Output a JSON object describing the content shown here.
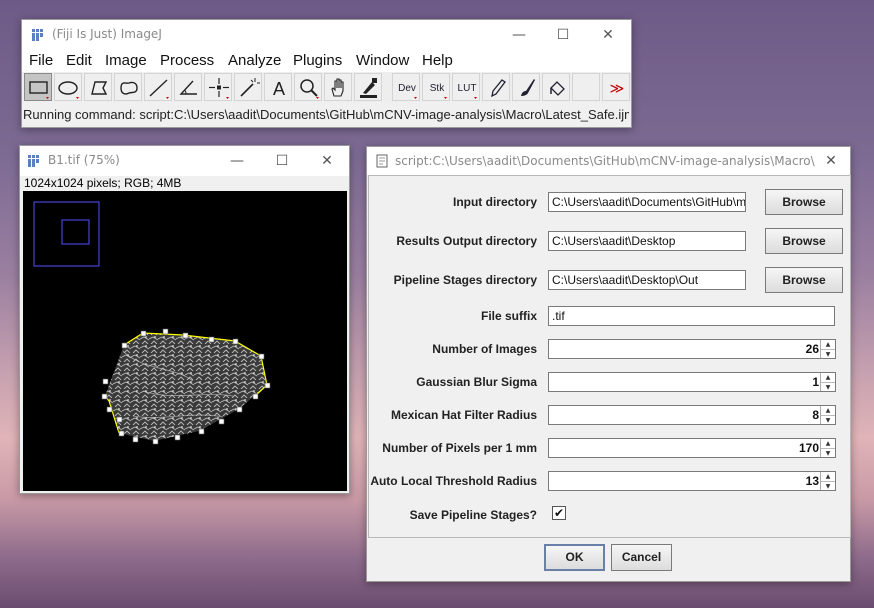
{
  "imagej": {
    "title": "(Fiji Is Just) ImageJ",
    "menus": [
      "File",
      "Edit",
      "Image",
      "Process",
      "Analyze",
      "Plugins",
      "Window",
      "Help"
    ],
    "tools": [
      {
        "name": "rectangle-tool-icon",
        "label": ""
      },
      {
        "name": "oval-tool-icon",
        "label": ""
      },
      {
        "name": "polygon-tool-icon",
        "label": ""
      },
      {
        "name": "freehand-tool-icon",
        "label": ""
      },
      {
        "name": "line-tool-icon",
        "label": ""
      },
      {
        "name": "angle-tool-icon",
        "label": ""
      },
      {
        "name": "point-tool-icon",
        "label": ""
      },
      {
        "name": "wand-tool-icon",
        "label": ""
      },
      {
        "name": "text-tool-icon",
        "label": "A"
      },
      {
        "name": "magnifier-tool-icon",
        "label": ""
      },
      {
        "name": "hand-tool-icon",
        "label": ""
      },
      {
        "name": "dropper-tool-icon",
        "label": ""
      },
      {
        "name": "dev-tool-icon",
        "label": "Dev"
      },
      {
        "name": "stk-tool-icon",
        "label": "Stk"
      },
      {
        "name": "lut-tool-icon",
        "label": "LUT"
      },
      {
        "name": "pencil-tool-icon",
        "label": ""
      },
      {
        "name": "brush-tool-icon",
        "label": ""
      },
      {
        "name": "flood-fill-tool-icon",
        "label": ""
      },
      {
        "name": "empty-tool-slot",
        "label": ""
      },
      {
        "name": "more-tools-icon",
        "label": "≫"
      }
    ],
    "status": "Running command: script:C:\\Users\\aadit\\Documents\\GitHub\\mCNV-image-analysis\\Macro\\Latest_Safe.ijm"
  },
  "image_window": {
    "title": "B1.tif (75%)",
    "info": "1024x1024 pixels; RGB; 4MB"
  },
  "dialog": {
    "title": "script:C:\\Users\\aadit\\Documents\\GitHub\\mCNV-image-analysis\\Macro\\Latest_Safe.ijm",
    "fields": {
      "input_dir": {
        "label": "Input directory",
        "value": "C:\\Users\\aadit\\Documents\\GitHub\\mCNV-image-analysis",
        "button": "Browse"
      },
      "results_dir": {
        "label": "Results Output directory",
        "value": "C:\\Users\\aadit\\Desktop",
        "button": "Browse"
      },
      "stages_dir": {
        "label": "Pipeline Stages directory",
        "value": "C:\\Users\\aadit\\Desktop\\Out",
        "button": "Browse"
      },
      "file_suffix": {
        "label": "File suffix",
        "value": ".tif"
      },
      "num_images": {
        "label": "Number of Images",
        "value": "26"
      },
      "blur_sigma": {
        "label": "Gaussian Blur Sigma",
        "value": "1"
      },
      "mexhat_radius": {
        "label": "Mexican Hat Filter Radius",
        "value": "8"
      },
      "px_per_mm": {
        "label": "Number of Pixels per 1 mm",
        "value": "170"
      },
      "thresh_radius": {
        "label": "Auto Local Threshold Radius",
        "value": "13"
      },
      "save_stages": {
        "label": "Save Pipeline Stages?",
        "checked": true
      }
    },
    "ok": "OK",
    "cancel": "Cancel"
  },
  "colors": {
    "selection_outline": "#ffff00",
    "roi_box": "#5050ff",
    "default_button_border": "#6a7fa8"
  }
}
